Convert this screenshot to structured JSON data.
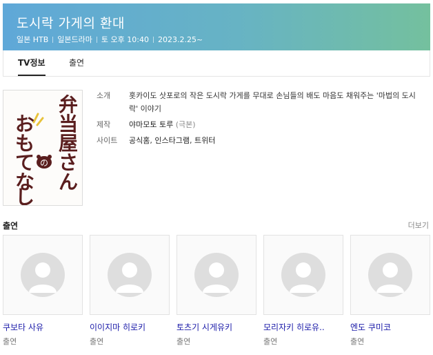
{
  "header": {
    "title": "도시락 가게의 환대",
    "meta": [
      "일본 HTB",
      "일본드라마",
      "토 오후 10:40",
      "2023.2.25~"
    ],
    "gradient_start": "#5fa8d8",
    "gradient_end": "#74c09e"
  },
  "tabs": [
    {
      "label": "TV정보",
      "active": true
    },
    {
      "label": "출연",
      "active": false
    }
  ],
  "poster": {
    "line1": "弁当屋さん",
    "line2": "おもてなし",
    "badge": "の",
    "ink_color": "#5a1e1e",
    "accent_color": "#e8c23a"
  },
  "info": {
    "intro_label": "소개",
    "intro_text": "홋카이도 삿포로의 작은 도시락 가게를 무대로 손님들의 배도 마음도 채워주는 '마법의 도시락' 이야기",
    "production_label": "제작",
    "production_value": "야마모토 토루",
    "production_sub": "(극본)",
    "site_label": "사이트",
    "sites": [
      "공식홈",
      "인스타그램",
      "트위터"
    ]
  },
  "cast_section": {
    "title": "출연",
    "more_label": "더보기",
    "members": [
      {
        "name": "쿠보타 사유",
        "role": "출연"
      },
      {
        "name": "이이지마 히로키",
        "role": "출연"
      },
      {
        "name": "토츠기 시게유키",
        "role": "출연"
      },
      {
        "name": "모리자키 히로유..",
        "role": "출연"
      },
      {
        "name": "엔도 쿠미코",
        "role": "출연"
      }
    ]
  }
}
